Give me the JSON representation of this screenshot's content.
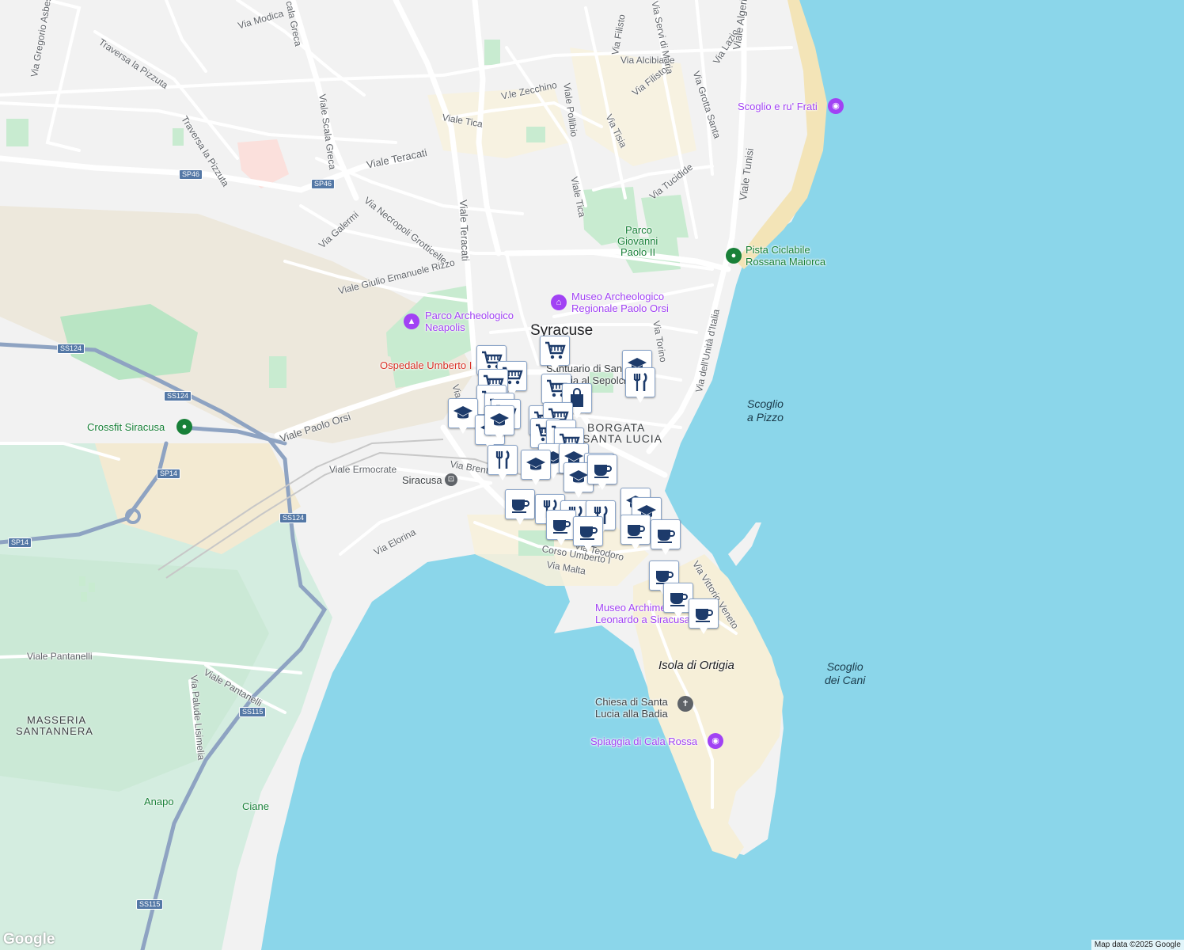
{
  "map": {
    "city": "Syracuse",
    "district": [
      "BORGATA",
      "SANTA LUCIA"
    ],
    "island": "Isola di Ortigia",
    "attribution": "Map data ©2025 Google",
    "google_logo": "Google",
    "colors": {
      "sea": "#8bd6ea",
      "land": "#f2f2f2",
      "park": "#c8ebd0",
      "road": "#ffffff",
      "highway": "#8ea3c2",
      "sand": "#f5ecd3",
      "marker_icon": "#1d3b6b"
    },
    "streets": {
      "via_gregorio": "Via Gregorio Asbesta",
      "via_modica": "Via Modica",
      "scala_greca_top": "cala Greca",
      "traversa_pizzuta_1": "Traversa la Pizzuta",
      "traversa_pizzuta_2": "Traversa la Pizzuta",
      "viale_scala_greca": "Viale Scala Greca",
      "viale_teracati_1": "Viale Teracati",
      "viale_teracati_2": "Viale Teracati",
      "via_necropoli": "Via Necropoli Grotticelle",
      "via_galermi": "Via Galermi",
      "viale_giulio": "Viale Giulio Emanuele Rizzo",
      "v_zecchino": "V.le Zecchino",
      "viale_tica_1": "Viale Tica",
      "viale_tica_2": "Viale Tica",
      "viale_pollibio": "Viale Pollibio",
      "via_tisia": "Via Tisia",
      "via_filisto_1": "Via Filisto",
      "via_filisto_2": "Via Filisto",
      "via_alcibiade": "Via Alcibiade",
      "via_servi": "Via Servi di Maria",
      "via_lazio": "Via Lazio",
      "viale_algeri": "Viale Algeri",
      "via_grotta": "Via Grotta Santa",
      "viale_tunisi": "Viale Tunisi",
      "via_tucidide": "Via Tucidide",
      "via_torino": "Via Torino",
      "via_unita": "Via dell'Unità d'Italia",
      "viale_paolo_orsi": "Viale Paolo Orsi",
      "viale_ermocrate": "Viale Ermocrate",
      "via_brenta": "Via Brenta",
      "via_elorina": "Via Elorina",
      "corso_umberto": "Corso Umberto I",
      "via_malta": "Via Malta",
      "via_teodoro": "Via Teodoro",
      "via_vittorio": "Via Vittorio Veneto",
      "viale_pantanelli_1": "Viale Pantanelli",
      "viale_pantanelli_2": "Viale Pantanelli",
      "via_palude": "Via Palude Lisimelia",
      "via_partial": "Via T"
    },
    "places": {
      "masseria": [
        "MASSERIA",
        "SANTANNERA"
      ],
      "anapo": "Anapo",
      "ciane": "Ciane",
      "parco_giovanni": [
        "Parco",
        "Giovanni",
        "Paolo II"
      ],
      "siracusa_station": "Siracusa"
    },
    "sea_labels": {
      "scoglio_pizzo": [
        "Scoglio",
        "a Pizzo"
      ],
      "scoglio_cani": [
        "Scoglio",
        "dei Cani"
      ]
    },
    "shields": {
      "sp46a": "SP46",
      "sp46b": "SP46",
      "ss124a": "SS124",
      "ss124b": "SS124",
      "sp14a": "SP14",
      "sp14b": "SP14",
      "ss115a": "SS115",
      "ss115b": "SS115"
    },
    "pois": {
      "scoglio_frati": "Scoglio e ru' Frati",
      "pista": [
        "Pista Ciclabile",
        "Rossana Maiorca"
      ],
      "museo_orsi": [
        "Museo Archeologico",
        "Regionale Paolo Orsi"
      ],
      "parco_neapolis": [
        "Parco Archeologico",
        "Neapolis"
      ],
      "ospedale": "Ospedale Umberto I",
      "santuario": [
        "Santuario di Santa",
        "Lucia al Sepolcro"
      ],
      "crossfit": "Crossfit Siracusa",
      "museo_leonardo": [
        "Museo Archimede",
        "Leonardo a Siracusa"
      ],
      "chiesa": [
        "Chiesa di Santa",
        "Lucia alla Badia"
      ],
      "spiaggia": "Spiaggia di Cala Rossa"
    },
    "icons": {
      "museum": "museum-icon",
      "park": "park-icon",
      "camera": "camera-icon",
      "church": "church-icon",
      "train": "train-icon",
      "cart": "shopping-cart-icon",
      "bag": "shopping-bag-icon",
      "school": "school-icon",
      "restaurant": "restaurant-icon",
      "cafe": "cafe-icon"
    },
    "markers": [
      {
        "type": "cart"
      },
      {
        "type": "cart"
      },
      {
        "type": "cart"
      },
      {
        "type": "cart"
      },
      {
        "type": "school"
      },
      {
        "type": "restaurant"
      },
      {
        "type": "cart"
      },
      {
        "type": "cart"
      },
      {
        "type": "bag"
      },
      {
        "type": "cart"
      },
      {
        "type": "school"
      },
      {
        "type": "cart"
      },
      {
        "type": "school"
      },
      {
        "type": "school"
      },
      {
        "type": "cart"
      },
      {
        "type": "cart"
      },
      {
        "type": "cart"
      },
      {
        "type": "cart"
      },
      {
        "type": "cart"
      },
      {
        "type": "school"
      },
      {
        "type": "restaurant"
      },
      {
        "type": "school"
      },
      {
        "type": "school"
      },
      {
        "type": "cafe"
      },
      {
        "type": "school"
      },
      {
        "type": "cafe"
      },
      {
        "type": "school"
      },
      {
        "type": "school"
      },
      {
        "type": "cafe"
      },
      {
        "type": "restaurant"
      },
      {
        "type": "restaurant"
      },
      {
        "type": "restaurant"
      },
      {
        "type": "cafe"
      },
      {
        "type": "cafe"
      },
      {
        "type": "cafe"
      },
      {
        "type": "cafe"
      },
      {
        "type": "cafe"
      },
      {
        "type": "cafe"
      },
      {
        "type": "cafe"
      }
    ]
  }
}
